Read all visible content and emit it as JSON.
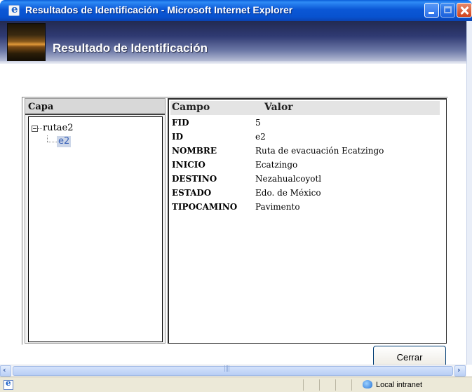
{
  "window": {
    "title": "Resultados de Identificación - Microsoft Internet Explorer"
  },
  "header": {
    "title": "Resultado de Identificación"
  },
  "layer_panel": {
    "header": "Capa",
    "tree": {
      "root": "rutae2",
      "children": [
        "e2"
      ]
    }
  },
  "attributes": {
    "columns": {
      "field": "Campo",
      "value": "Valor"
    },
    "rows": [
      {
        "field": "FID",
        "value": "5"
      },
      {
        "field": "ID",
        "value": "e2"
      },
      {
        "field": "NOMBRE",
        "value": "Ruta de evacuación Ecatzingo"
      },
      {
        "field": "INICIO",
        "value": "Ecatzingo"
      },
      {
        "field": "DESTINO",
        "value": "Nezahualcoyotl"
      },
      {
        "field": "ESTADO",
        "value": "Edo. de México"
      },
      {
        "field": "TIPOCAMINO",
        "value": "Pavimento"
      }
    ]
  },
  "buttons": {
    "close_label": "Cerrar"
  },
  "statusbar": {
    "zone": "Local intranet"
  },
  "icons": {
    "window": "ie-page-icon",
    "zone": "intranet-globe-icon"
  }
}
